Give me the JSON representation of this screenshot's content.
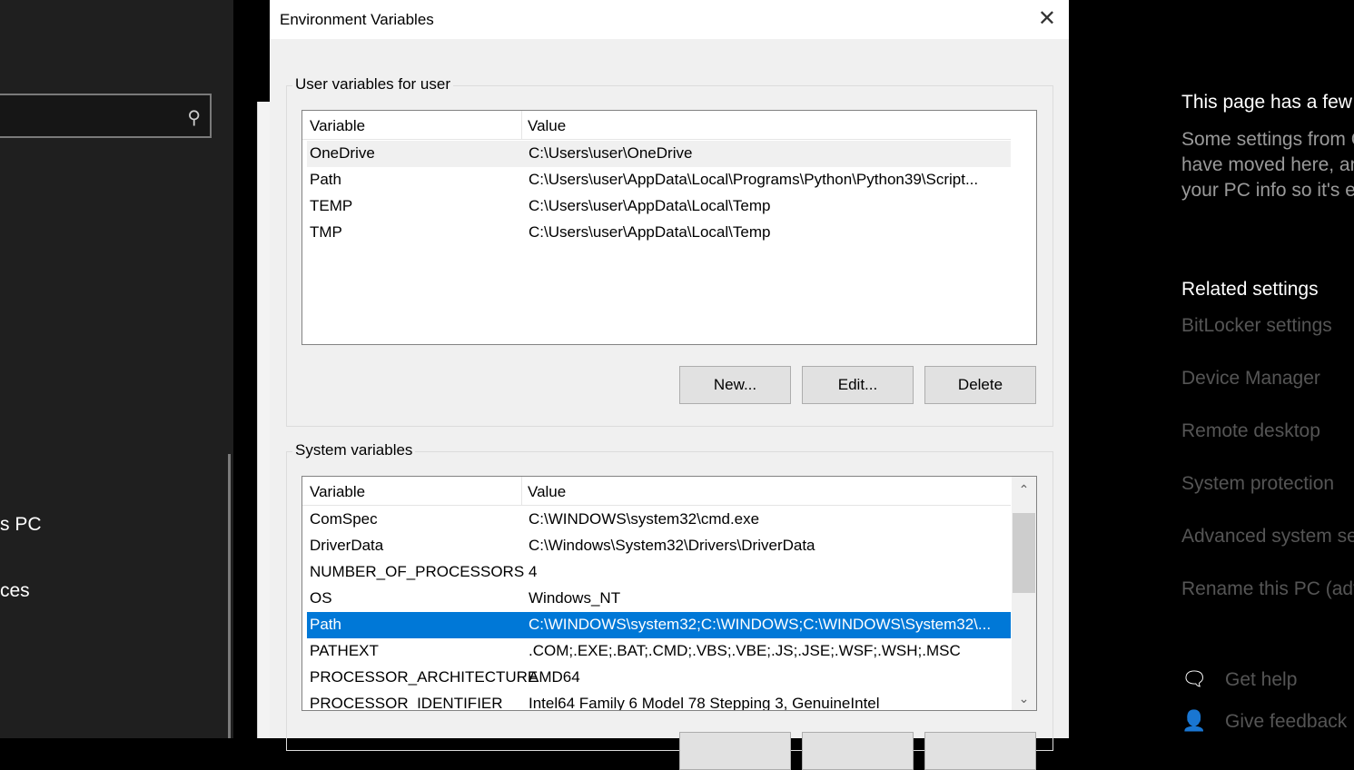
{
  "sidebar": {
    "search_icon": "search-icon",
    "item1": "s PC",
    "item2": "ces"
  },
  "dialog": {
    "title": "Environment Variables",
    "user_group": "User variables for user",
    "system_group": "System variables",
    "col_variable": "Variable",
    "col_value": "Value",
    "user_vars": [
      {
        "name": "OneDrive",
        "value": "C:\\Users\\user\\OneDrive"
      },
      {
        "name": "Path",
        "value": "C:\\Users\\user\\AppData\\Local\\Programs\\Python\\Python39\\Script..."
      },
      {
        "name": "TEMP",
        "value": "C:\\Users\\user\\AppData\\Local\\Temp"
      },
      {
        "name": "TMP",
        "value": "C:\\Users\\user\\AppData\\Local\\Temp"
      }
    ],
    "system_vars": [
      {
        "name": "ComSpec",
        "value": "C:\\WINDOWS\\system32\\cmd.exe"
      },
      {
        "name": "DriverData",
        "value": "C:\\Windows\\System32\\Drivers\\DriverData"
      },
      {
        "name": "NUMBER_OF_PROCESSORS",
        "value": "4"
      },
      {
        "name": "OS",
        "value": "Windows_NT"
      },
      {
        "name": "Path",
        "value": "C:\\WINDOWS\\system32;C:\\WINDOWS;C:\\WINDOWS\\System32\\..."
      },
      {
        "name": "PATHEXT",
        "value": ".COM;.EXE;.BAT;.CMD;.VBS;.VBE;.JS;.JSE;.WSF;.WSH;.MSC"
      },
      {
        "name": "PROCESSOR_ARCHITECTURE",
        "value": "AMD64"
      },
      {
        "name": "PROCESSOR_IDENTIFIER",
        "value": "Intel64 Family 6 Model 78 Stepping 3, GenuineIntel"
      }
    ],
    "buttons": {
      "new": "New...",
      "edit": "Edit...",
      "delete": "Delete"
    }
  },
  "right_panel": {
    "heading": "This page has a few n",
    "desc": [
      "Some settings from C",
      "have moved here, an",
      "your PC info so it's e"
    ],
    "related": "Related settings",
    "links": [
      "BitLocker settings",
      "Device Manager",
      "Remote desktop",
      "System protection",
      "Advanced system se",
      "Rename this PC (adv"
    ],
    "help": "Get help",
    "feedback": "Give feedback"
  },
  "colors": {
    "selection": "#0078d7"
  }
}
